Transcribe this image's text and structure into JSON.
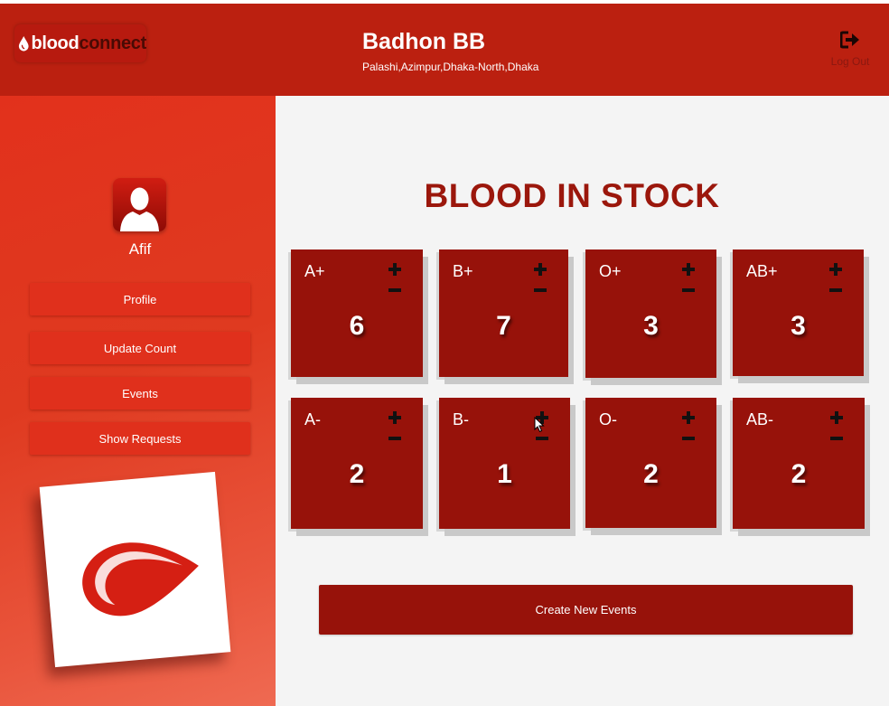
{
  "header": {
    "logo": {
      "word1": "blood",
      "word2": "connect"
    },
    "bank_name": "Badhon BB",
    "bank_address": "Palashi,Azimpur,Dhaka-North,Dhaka",
    "logout_label": "Log Out",
    "logout_icon": "sign-out-icon"
  },
  "sidebar": {
    "avatar_icon": "user-silhouette-icon",
    "username": "Afif",
    "menu": [
      {
        "label": "Profile"
      },
      {
        "label": "Update Count"
      },
      {
        "label": "Events"
      },
      {
        "label": "Show Requests"
      }
    ],
    "logo_card_icon": "blood-drop-logo"
  },
  "main": {
    "title": "BLOOD IN STOCK",
    "stock": [
      {
        "type": "A+",
        "count": "6"
      },
      {
        "type": "B+",
        "count": "7"
      },
      {
        "type": "O+",
        "count": "3"
      },
      {
        "type": "AB+",
        "count": "3"
      },
      {
        "type": "A-",
        "count": "2"
      },
      {
        "type": "B-",
        "count": "1"
      },
      {
        "type": "O-",
        "count": "2"
      },
      {
        "type": "AB-",
        "count": "2"
      }
    ],
    "increment_icon": "plus-icon",
    "decrement_icon": "minus-icon",
    "create_button": "Create New Events"
  },
  "colors": {
    "header_bg": "#bb2010",
    "sidebar_bg": "#e2311c",
    "card_bg": "#97120a",
    "title_color": "#9b170c",
    "main_bg": "#f4f4f4"
  }
}
